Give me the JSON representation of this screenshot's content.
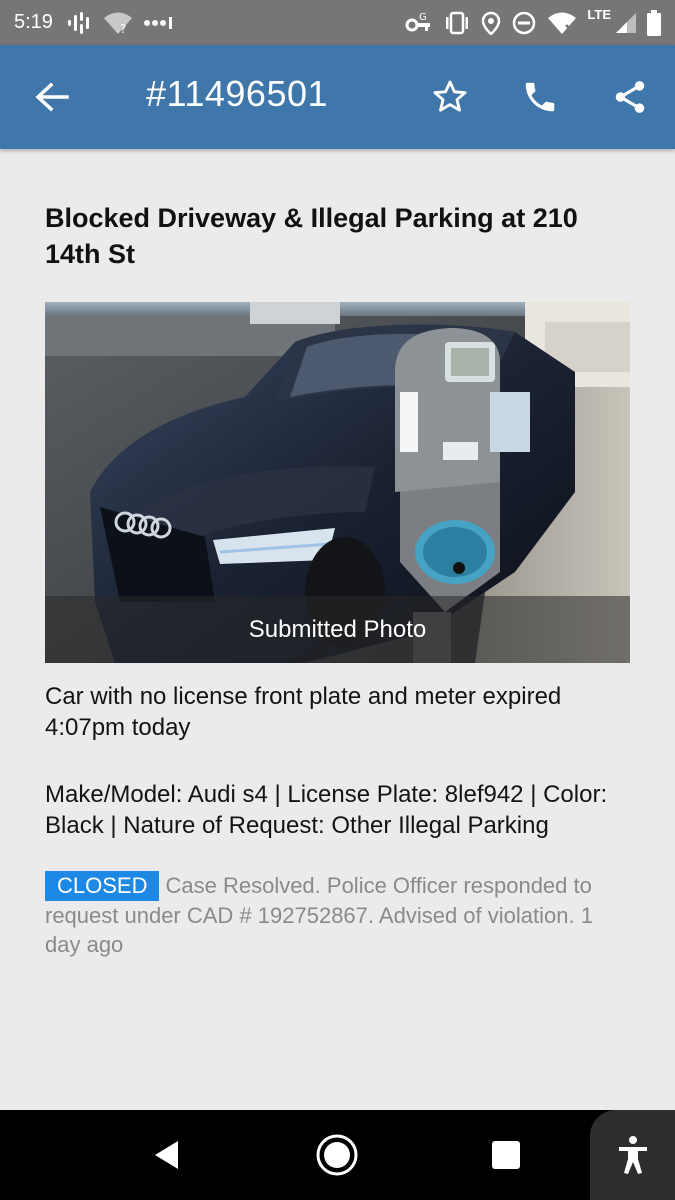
{
  "status_bar": {
    "time": "5:19",
    "network": "LTE",
    "icons_left": [
      "podcast-icon",
      "wifi-question-icon",
      "more-dots-icon"
    ],
    "icons_right": [
      "vpn-key-icon",
      "vibrate-icon",
      "location-icon",
      "do-not-disturb-icon",
      "wifi-x-icon",
      "signal-icon",
      "battery-icon"
    ]
  },
  "app_bar": {
    "title": "#11496501",
    "color": "#3f77aa",
    "actions": [
      "star-icon",
      "phone-icon",
      "share-icon"
    ]
  },
  "request": {
    "title": "Blocked Driveway & Illegal Parking at 210 14th St",
    "photo_caption": "Submitted Photo",
    "description": "Car with no license front plate and meter expired 4:07pm today",
    "details": "Make/Model: Audi s4 | License Plate: 8lef942 | Color: Black | Nature of Request: Other Illegal Parking",
    "status_label": "CLOSED",
    "status_color": "#1e88e5",
    "status_text": "Case Resolved. Police Officer responded to request under CAD # 192752867. Advised of violation. 1 day ago"
  },
  "nav_bar": {
    "buttons": [
      "back-triangle-icon",
      "home-circle-icon",
      "recents-square-icon",
      "accessibility-icon"
    ]
  }
}
